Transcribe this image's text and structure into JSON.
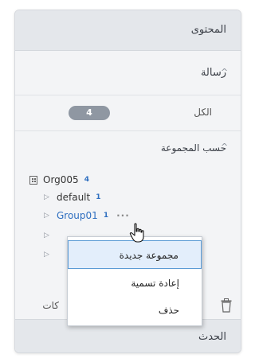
{
  "sections": {
    "content_title": "المحتوى",
    "message_title": "رسالة",
    "all_label": "الكل",
    "all_count": "4",
    "by_group_title": "حسب المجموعة",
    "edit_label": "كات",
    "event_title": "الحدث"
  },
  "tree": {
    "org": {
      "label": "Org005",
      "count": "4"
    },
    "items": [
      {
        "label": "default",
        "count": "1"
      },
      {
        "label": "Group01",
        "count": "1"
      }
    ],
    "more_label": "···"
  },
  "context_menu": {
    "items": [
      "مجموعة جديدة",
      "إعادة تسمية",
      "حذف"
    ],
    "highlighted": 0
  },
  "icons": {
    "caret": "chevron-up-icon",
    "tree_toggle": "triangle-right-icon",
    "org": "org-building-icon",
    "trash": "trash-icon",
    "cursor": "hand-pointer-icon"
  },
  "colors": {
    "link": "#2f6fc0",
    "badge": "#8f97a2",
    "menu_highlight": "#e3eefb"
  }
}
